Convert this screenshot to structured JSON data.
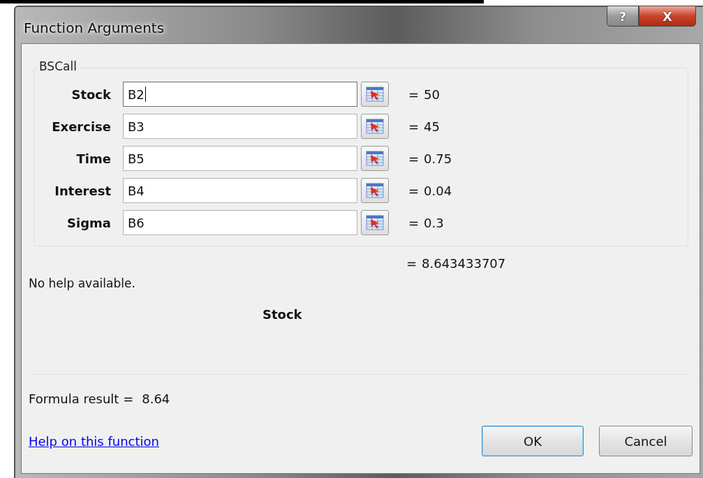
{
  "window": {
    "title": "Function Arguments",
    "buttons": [
      "?",
      "X"
    ]
  },
  "function_name": "BSCall",
  "arguments": [
    {
      "label": "Stock",
      "value": "B2",
      "result": "50",
      "focused": true
    },
    {
      "label": "Exercise",
      "value": "B3",
      "result": "45",
      "focused": false
    },
    {
      "label": "Time",
      "value": "B5",
      "result": "0.75",
      "focused": false
    },
    {
      "label": "Interest",
      "value": "B4",
      "result": "0.04",
      "focused": false
    },
    {
      "label": "Sigma",
      "value": "B6",
      "result": "0.3",
      "focused": false
    }
  ],
  "equals": "=",
  "function_result": "8.643433707",
  "description": "No help available.",
  "argument_help": "Stock",
  "formula_result": {
    "label": "Formula result =",
    "value": "8.64"
  },
  "help_link": "Help on this function",
  "buttons": [
    {
      "label": "OK",
      "default": true
    },
    {
      "label": "Cancel",
      "default": false
    }
  ]
}
